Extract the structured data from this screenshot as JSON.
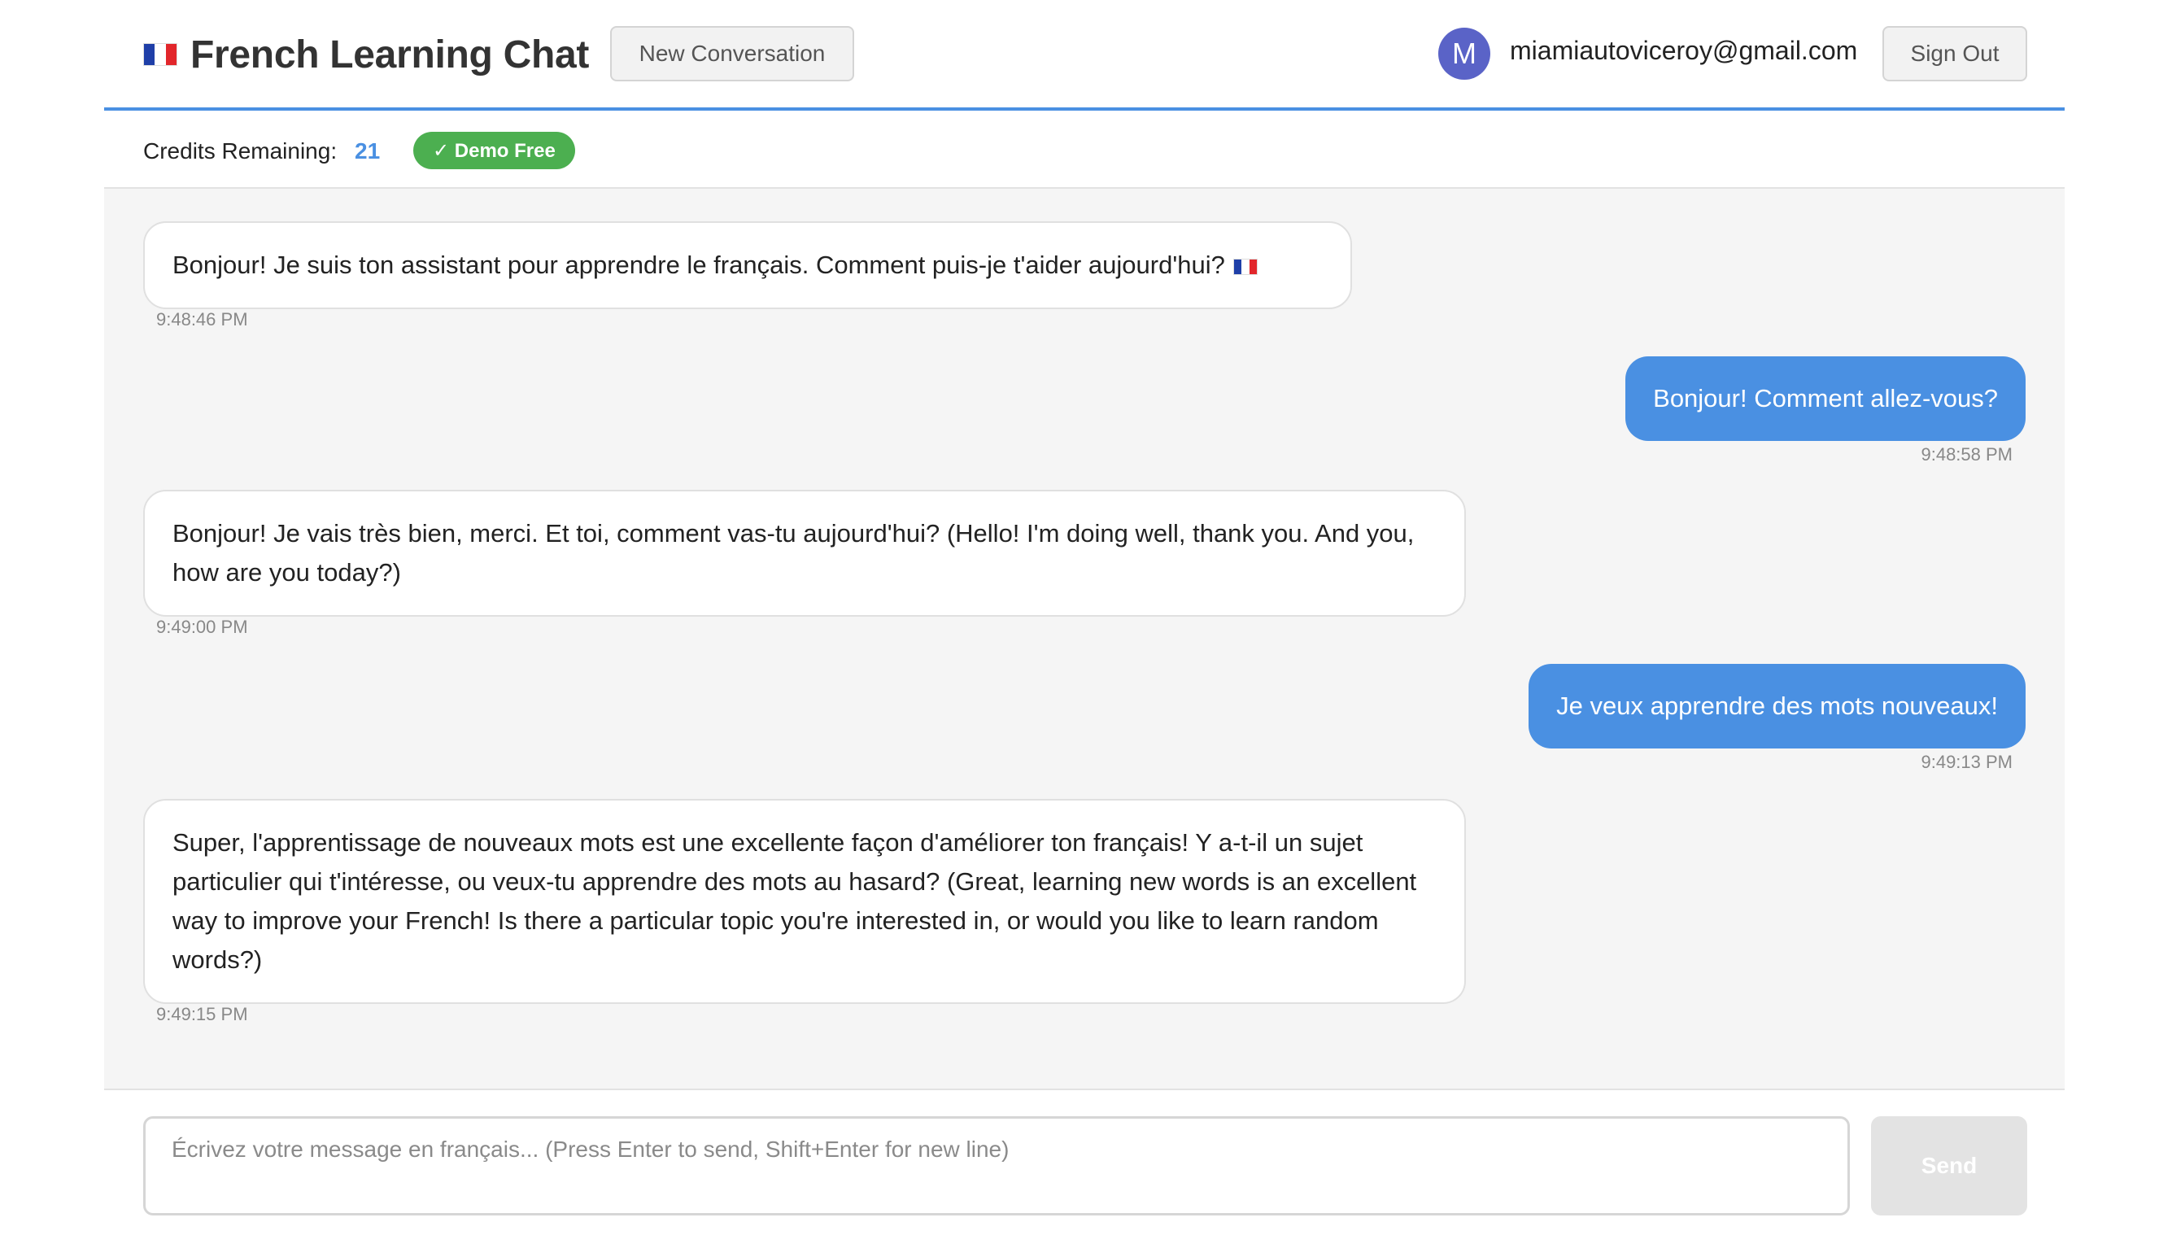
{
  "header": {
    "title": "French Learning Chat",
    "new_conversation_label": "New Conversation",
    "avatar_initial": "M",
    "user_email": "miamiautoviceroy@gmail.com",
    "sign_out_label": "Sign Out"
  },
  "credits": {
    "label": "Credits Remaining:",
    "value": "21",
    "badge": "✓ Demo Free"
  },
  "messages": [
    {
      "role": "assistant",
      "text": "Bonjour! Je suis ton assistant pour apprendre le français. Comment puis-je t'aider aujourd'hui?",
      "time": "9:48:46 PM"
    },
    {
      "role": "user",
      "text": "Bonjour! Comment allez-vous?",
      "time": "9:48:58 PM"
    },
    {
      "role": "assistant",
      "text": "Bonjour! Je vais très bien, merci. Et toi, comment vas-tu aujourd'hui? (Hello! I'm doing well, thank you. And you, how are you today?)",
      "time": "9:49:00 PM"
    },
    {
      "role": "user",
      "text": "Je veux apprendre des mots nouveaux!",
      "time": "9:49:13 PM"
    },
    {
      "role": "assistant",
      "text": "Super, l'apprentissage de nouveaux mots est une excellente façon d'améliorer ton français! Y a-t-il un sujet particulier qui t'intéresse, ou veux-tu apprendre des mots au hasard? (Great, learning new words is an excellent way to improve your French! Is there a particular topic you're interested in, or would you like to learn random words?)",
      "time": "9:49:15 PM"
    }
  ],
  "composer": {
    "placeholder": "Écrivez votre message en français... (Press Enter to send, Shift+Enter for new line)",
    "value": "",
    "send_label": "Send"
  },
  "colors": {
    "accent": "#4a90e2",
    "badge_green": "#4caf50",
    "avatar": "#5a63c7",
    "chat_background": "#f5f5f5"
  },
  "icons": {
    "brand": "french-flag-icon",
    "first_message": "french-flag-icon"
  }
}
